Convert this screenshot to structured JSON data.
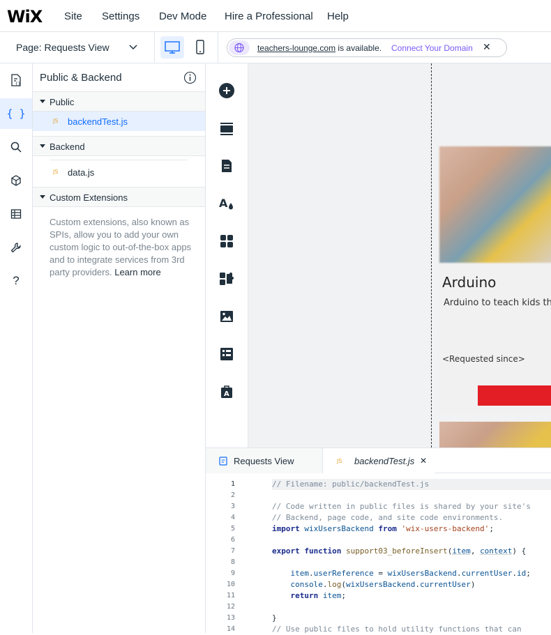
{
  "topbar": {
    "logo": "WiX",
    "menu": [
      "Site",
      "Settings",
      "Dev Mode",
      "Hire a Professional",
      "Help"
    ]
  },
  "secbar": {
    "page_label": "Page: Requests View",
    "domain": "teachers-lounge.com",
    "domain_suffix": " is available.",
    "connect": "Connect Your Domain",
    "close": "✕"
  },
  "panel": {
    "title": "Public & Backend",
    "sections": [
      {
        "label": "Public",
        "files": [
          {
            "name": "backendTest.js",
            "badge": "JS"
          }
        ]
      },
      {
        "label": "Backend",
        "files": [
          {
            "name": "data.js",
            "badge": "JS"
          }
        ]
      },
      {
        "label": "Custom Extensions"
      }
    ],
    "description": "Custom extensions, also known as SPIs, allow you to add your own custom logic to out-of-the-box apps and to integrate services from 3rd party providers.",
    "learn_more": "Learn more"
  },
  "canvas": {
    "card_title": "Arduino",
    "card_desc": "Arduino to teach kids the",
    "card_requested": "<Requested since>"
  },
  "editor": {
    "tabs": [
      {
        "label": "Requests View"
      },
      {
        "label": "backendTest.js",
        "badge": "JS",
        "close": "✕"
      }
    ],
    "line_numbers": [
      "1",
      "2",
      "3",
      "4",
      "5",
      "6",
      "7",
      "8",
      "9",
      "10",
      "11",
      "12",
      "13",
      "14"
    ]
  },
  "colors": {
    "accent": "#116dff",
    "connect": "#7a5af8",
    "button_red": "#e31e24",
    "selected_bg": "#e7f0ff"
  }
}
